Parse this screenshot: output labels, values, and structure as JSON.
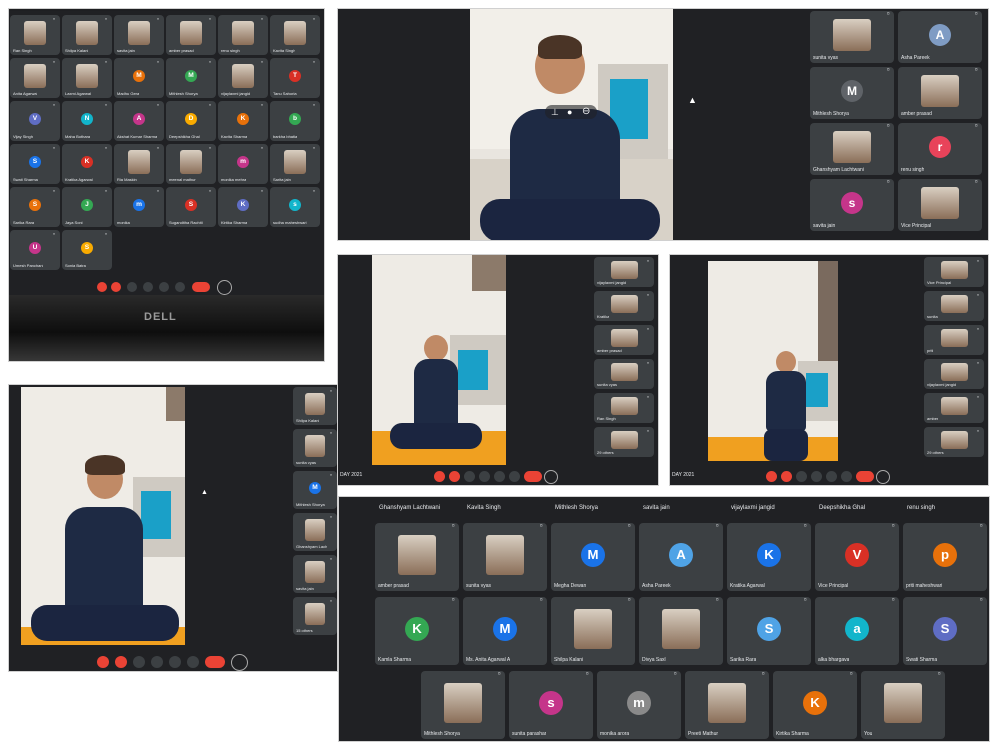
{
  "panel1": {
    "laptop_brand": "DELL",
    "tiles": [
      {
        "name": "Ran Singh",
        "letter": ""
      },
      {
        "name": "Shilpa Kalani",
        "letter": ""
      },
      {
        "name": "savita jain",
        "letter": ""
      },
      {
        "name": "amber prasad",
        "letter": ""
      },
      {
        "name": "renu singh",
        "letter": ""
      },
      {
        "name": "Kavita Singh",
        "letter": ""
      },
      {
        "name": "Anita Agarwal",
        "letter": ""
      },
      {
        "name": "Laxmi Agarwal",
        "letter": ""
      },
      {
        "name": "Madhu Gera",
        "letter": "M"
      },
      {
        "name": "Mithlesh Shorya",
        "letter": "M"
      },
      {
        "name": "vijaylaxmi jangid",
        "letter": ""
      },
      {
        "name": "Tanu Sahoria",
        "letter": "T"
      },
      {
        "name": "Vijay Singh",
        "letter": "V"
      },
      {
        "name": "Maha Bothara",
        "letter": "N"
      },
      {
        "name": "Akshat Kumar Sharma",
        "letter": "A"
      },
      {
        "name": "Deepshikha Ghal",
        "letter": "D"
      },
      {
        "name": "Kavita Sharma",
        "letter": "K"
      },
      {
        "name": "barkha bhatia",
        "letter": "b"
      },
      {
        "name": "Swati Sharma",
        "letter": "S"
      },
      {
        "name": "Kratika Agarwal",
        "letter": "K"
      },
      {
        "name": "Ria Maskin",
        "letter": ""
      },
      {
        "name": "meenal mathur",
        "letter": ""
      },
      {
        "name": "monika mehra",
        "letter": "m"
      },
      {
        "name": "Sarita jain",
        "letter": ""
      },
      {
        "name": "Sarika Rara",
        "letter": "S"
      },
      {
        "name": "Jaya Soni",
        "letter": "J"
      },
      {
        "name": "monika",
        "letter": "m"
      },
      {
        "name": "Suganditha Rachiti",
        "letter": "S"
      },
      {
        "name": "Kirtika Sharma",
        "letter": "K"
      },
      {
        "name": "sudha maheshwari",
        "letter": "s"
      },
      {
        "name": "Umesh Panchani",
        "letter": "U"
      },
      {
        "name": "Sonia Batra",
        "letter": "S"
      }
    ]
  },
  "panel2": {
    "tiles": [
      {
        "name": "sunita vyas",
        "letter": ""
      },
      {
        "name": "Asha Pareek",
        "letter": "A"
      },
      {
        "name": "Mithlesh Shorya",
        "letter": "M"
      },
      {
        "name": "amber prasad",
        "letter": ""
      },
      {
        "name": "Ghanshyam Lachtwani",
        "letter": ""
      },
      {
        "name": "renu singh",
        "letter": "r"
      },
      {
        "name": "savita jain",
        "letter": "s"
      },
      {
        "name": "Vice Principal",
        "letter": ""
      }
    ]
  },
  "panel3": {
    "footer": "DAY 2021",
    "tiles": [
      {
        "name": "vijaylaxmi jangid"
      },
      {
        "name": "Kratika"
      },
      {
        "name": "amber prasad"
      },
      {
        "name": "sunita vyas"
      },
      {
        "name": "Ran Singh"
      },
      {
        "name": "29 others"
      }
    ]
  },
  "panel4": {
    "footer": "DAY 2021",
    "tiles": [
      {
        "name": "Vice Principal"
      },
      {
        "name": "sunita"
      },
      {
        "name": "priti"
      },
      {
        "name": "vijaylaxmi jangid"
      },
      {
        "name": "amber"
      },
      {
        "name": "29 others"
      }
    ]
  },
  "panel5": {
    "tiles": [
      {
        "name": "Shilpa Kalani"
      },
      {
        "name": "sunita vyas"
      },
      {
        "name": "Mithlesh Shorya",
        "letter": "M"
      },
      {
        "name": "Ghanshyam Lach"
      },
      {
        "name": "savita jain"
      },
      {
        "name": "15 others"
      }
    ]
  },
  "panel6": {
    "top_names": [
      "Ghanshyam Lachtwani",
      "Kavita Singh",
      "Mithlesh Shorya",
      "savita jain",
      "vijaylaxmi jangid",
      "Deepshikha Ghal",
      "renu singh"
    ],
    "row1": [
      {
        "name": "amber prasad",
        "letter": "",
        "color": ""
      },
      {
        "name": "sunita vyas",
        "letter": "",
        "color": ""
      },
      {
        "name": "Megha Dewan",
        "letter": "M",
        "color": "#1a73e8"
      },
      {
        "name": "Asha Pareek",
        "letter": "A",
        "color": "#4fa3e6"
      },
      {
        "name": "Kratika Agarwal",
        "letter": "K",
        "color": "#1a73e8"
      },
      {
        "name": "Vice Principal",
        "letter": "V",
        "color": "#d93025"
      },
      {
        "name": "priti maheshwari",
        "letter": "p",
        "color": "#e8710a"
      }
    ],
    "row2": [
      {
        "name": "Kamla Sharma",
        "letter": "K",
        "color": "#34a853"
      },
      {
        "name": "Ms. Anita Agarwal A",
        "letter": "M",
        "color": "#1a73e8"
      },
      {
        "name": "Shilpa Kalani",
        "letter": "",
        "color": ""
      },
      {
        "name": "Divya Saxl",
        "letter": "",
        "color": ""
      },
      {
        "name": "Sarika Rara",
        "letter": "S",
        "color": "#4fa3e6"
      },
      {
        "name": "alka bhargava",
        "letter": "a",
        "color": "#12b5cb"
      },
      {
        "name": "Swati Sharma",
        "letter": "S",
        "color": "#5f6dc4"
      }
    ],
    "row3": [
      {
        "name": "Mithlesh Shorya",
        "letter": "",
        "color": ""
      },
      {
        "name": "sunita parashar",
        "letter": "s",
        "color": "#c5358a"
      },
      {
        "name": "monika arora",
        "letter": "m",
        "color": "#8a8a8a"
      },
      {
        "name": "Preeti Mathur",
        "letter": "",
        "color": ""
      },
      {
        "name": "Kirtika Sharma",
        "letter": "K",
        "color": "#e8710a"
      },
      {
        "name": "You",
        "letter": "",
        "color": ""
      }
    ]
  }
}
